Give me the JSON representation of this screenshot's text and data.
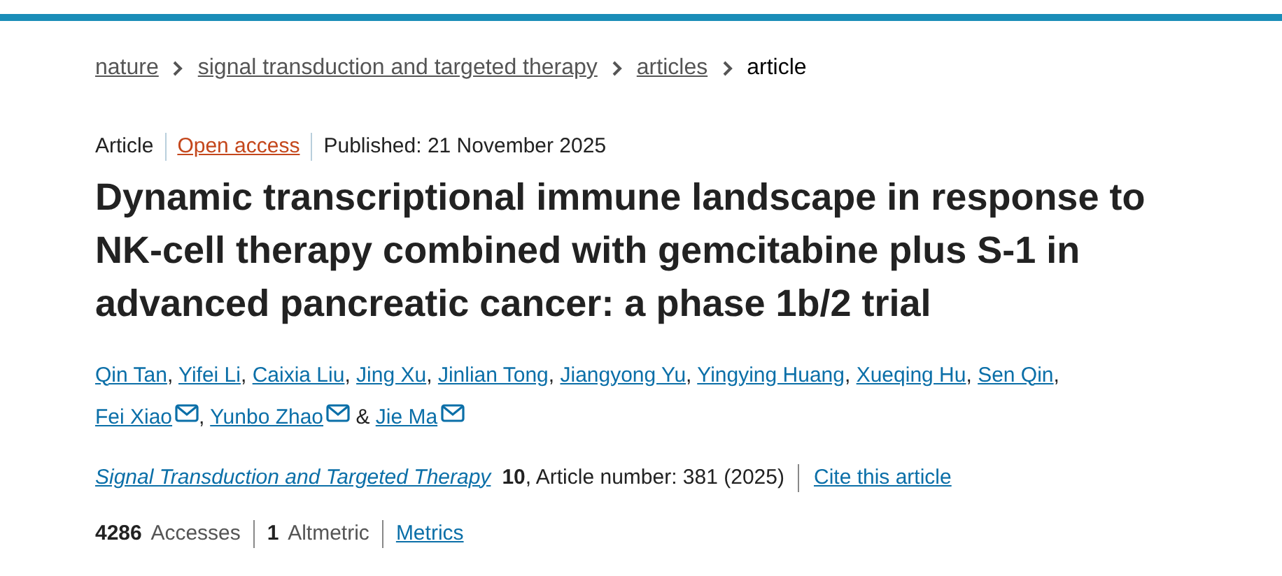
{
  "breadcrumb": [
    {
      "label": "nature",
      "kind": "link"
    },
    {
      "label": "signal transduction and targeted therapy",
      "kind": "link"
    },
    {
      "label": "articles",
      "kind": "link"
    },
    {
      "label": "article",
      "kind": "current"
    }
  ],
  "article_meta": {
    "type": "Article",
    "access": "Open access",
    "published": "Published: 21 November 2025"
  },
  "title": "Dynamic transcriptional immune landscape in response to NK-cell therapy combined with gemcitabine plus S-1 in advanced pancreatic cancer: a phase 1b/2 trial",
  "authors": [
    {
      "name": "Qin Tan",
      "email": false,
      "separator": ","
    },
    {
      "name": "Yifei Li",
      "email": false,
      "separator": ","
    },
    {
      "name": "Caixia Liu",
      "email": false,
      "separator": ","
    },
    {
      "name": "Jing Xu",
      "email": false,
      "separator": ","
    },
    {
      "name": "Jinlian Tong",
      "email": false,
      "separator": ","
    },
    {
      "name": "Jiangyong Yu",
      "email": false,
      "separator": ","
    },
    {
      "name": "Yingying Huang",
      "email": false,
      "separator": ","
    },
    {
      "name": "Xueqing Hu",
      "email": false,
      "separator": ","
    },
    {
      "name": "Sen Qin",
      "email": false,
      "separator": ","
    },
    {
      "name": "Fei Xiao",
      "email": true,
      "separator": ","
    },
    {
      "name": "Yunbo Zhao",
      "email": true,
      "separator": "&"
    },
    {
      "name": "Jie Ma",
      "email": true
    }
  ],
  "citation": {
    "journal": "Signal Transduction and Targeted Therapy",
    "volume": "10",
    "details": ", Article number: 381 (2025)",
    "cite_link": "Cite this article"
  },
  "metrics": [
    {
      "label": "**4286** Accesses",
      "kind": "stat"
    },
    {
      "label": "**1** Altmetric",
      "kind": "stat"
    },
    {
      "label": "Metrics",
      "kind": "link"
    }
  ]
}
